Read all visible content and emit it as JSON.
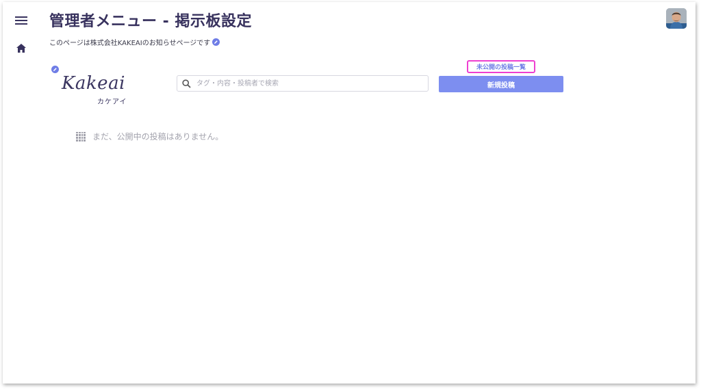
{
  "header": {
    "title": "管理者メニュー - 掲示板設定",
    "subtitle": "このページは株式会社KAKEAIのお知らせページです"
  },
  "sidebar": {
    "menu_icon": "hamburger-menu-icon",
    "home_icon": "home-icon"
  },
  "logo": {
    "main": "Kakeai",
    "sub": "カケアイ"
  },
  "search": {
    "placeholder": "タグ・内容・投稿者で検索",
    "value": ""
  },
  "actions": {
    "unpublished_label": "未公開の投稿一覧",
    "new_post_label": "新規投稿"
  },
  "empty_state": {
    "message": "まだ、公開中の投稿はありません。"
  },
  "colors": {
    "title": "#38325e",
    "accent": "#6f7de6",
    "button": "#7d8ef0",
    "highlight": "#ee3fd0"
  }
}
